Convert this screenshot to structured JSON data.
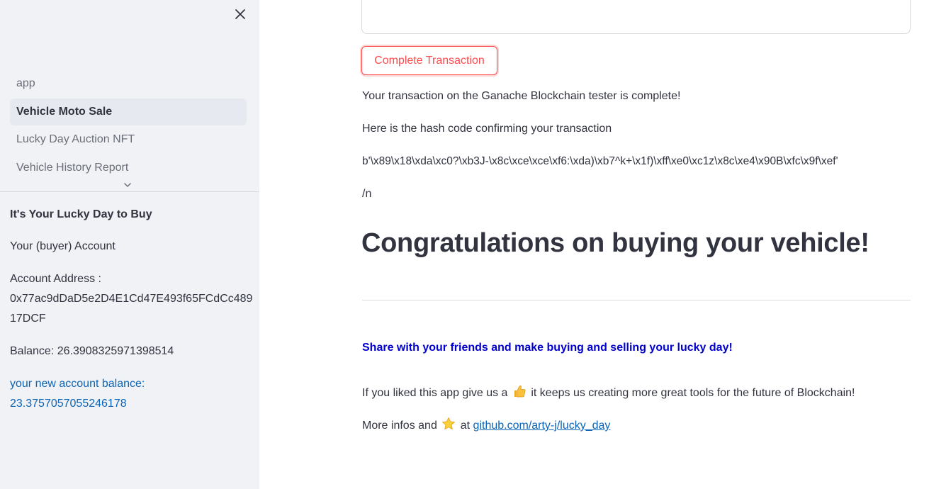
{
  "sidebar": {
    "nav": [
      {
        "label": "app",
        "active": false
      },
      {
        "label": "Vehicle Moto Sale",
        "active": true
      },
      {
        "label": "Lucky Day Auction NFT",
        "active": false
      },
      {
        "label": "Vehicle History Report",
        "active": false
      }
    ],
    "title": "It's Your Lucky Day to Buy",
    "account_header": "Your (buyer) Account",
    "address_label": "Account Address :",
    "address_line1": "0x77ac9dDaD5e2D4E1Cd47E493f65FCdCc489",
    "address_line2": "17DCF",
    "balance": "Balance: 26.3908325971398514",
    "new_balance_label": "your new account balance:",
    "new_balance_value": "23.3757057055246178"
  },
  "main": {
    "button_label": "Complete Transaction",
    "complete_message": "Your transaction on the Ganache Blockchain tester is complete!",
    "hash_intro": "Here is the hash code confirming your transaction",
    "hash_value": "b'\\x89\\x18\\xda\\xc0?\\xb3J-\\x8c\\xce\\xce\\xf6:\\xda)\\xb7^k+\\x1f)\\xff\\xe0\\xc1z\\x8c\\xe4\\x90B\\xfc\\x9f\\xef'",
    "newline_text": "/n",
    "heading": "Congratulations on buying your vehicle!",
    "share_text": "Share with your friends and make buying and selling your lucky day!",
    "like_before": "If you liked this app give us a",
    "like_after": "it keeps us creating more great tools for the future of Blockchain!",
    "more_before": "More infos and",
    "more_at": "at",
    "link_text": "github.com/arty-j/lucky_day"
  },
  "icons": {
    "close": "close-icon",
    "chevron": "chevron-down-icon",
    "thumbs_up": "thumbs-up-icon",
    "star": "star-icon"
  }
}
